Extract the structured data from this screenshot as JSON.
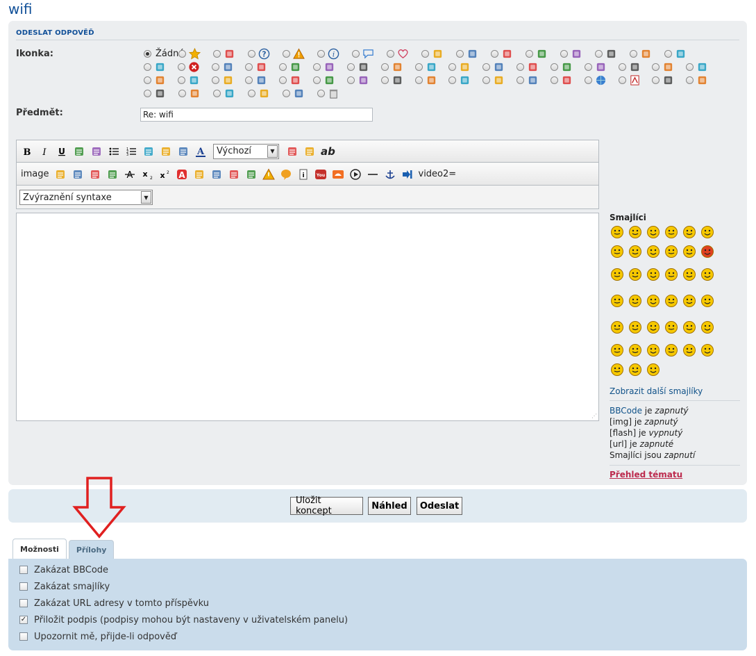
{
  "page": {
    "title": "wifi"
  },
  "form": {
    "heading": "Odeslat odpověď",
    "icon_label": "Ikonka:",
    "icon_none_label": "Žádné",
    "subject_label": "Předmět:",
    "subject_value": "Re: wifi"
  },
  "icons": [
    [
      "none",
      "star-icon",
      "radiation-icon",
      "question-icon",
      "warning-icon",
      "info-icon",
      "speech-bubble-icon",
      "heart-icon",
      "windows-icon",
      "tools-icon",
      "gear-icon",
      "pen-icon",
      "camera-icon",
      "music-icon",
      "back-icon",
      "sun-icon"
    ],
    [
      "lifebuoy-icon",
      "close-icon",
      "clock-icon",
      "traffic-light-icon",
      "monitor-icon",
      "laptop-icon",
      "calendar-icon",
      "padlock-icon",
      "film-icon",
      "printer-icon",
      "lightbulb-icon",
      "battery-icon",
      "palette-icon",
      "gamepad-icon",
      "antenna-icon",
      "signal-icon",
      "robot-icon"
    ],
    [
      "lifebuoy2-icon",
      "grid-icon",
      "document-icon",
      "apps-icon",
      "chart-icon",
      "database-icon",
      "picture-icon",
      "lock2-icon",
      "phone-icon",
      "keyboard-icon",
      "screen-icon",
      "photo-icon",
      "bar-chart-icon",
      "globe-icon",
      "pdf-icon",
      "floppy-icon",
      "print2-icon"
    ],
    [
      "cd-icon",
      "usb-icon",
      "stamp-icon",
      "flower-icon",
      "hat-icon",
      "trash-icon"
    ]
  ],
  "toolbar": {
    "row1": [
      "bold-icon",
      "italic-icon",
      "underline-icon",
      "quote-icon",
      "code-icon",
      "list-icon",
      "ordered-list-icon",
      "list-item-icon",
      "image-icon",
      "link-icon",
      "font-color-icon"
    ],
    "font_select": "Výchozí",
    "row1_tail": [
      "copy-icon",
      "paste-icon",
      "spellcheck-icon"
    ],
    "spellcheck_label": "ab",
    "image_label": "image",
    "row2": [
      "highlight-icon",
      "align-center-icon",
      "align-justify-icon",
      "align-right-icon",
      "strike-icon",
      "subscript-icon",
      "superscript-icon",
      "acronym-icon",
      "font-size-icon",
      "font-shadow-icon",
      "glow-icon",
      "direction-icon",
      "warning-icon",
      "spoiler-icon",
      "info-icon",
      "youtube-icon",
      "soundcloud-icon",
      "play-icon",
      "hr-icon",
      "anchor-icon",
      "arrow-icon"
    ],
    "video_label": "video2=",
    "syntax_select": "Zvýraznění syntaxe"
  },
  "smilies": {
    "title": "Smajlíci",
    "more_link": "Zobrazit další smajlíky",
    "rows": [
      6,
      6,
      6,
      6,
      6,
      6,
      3
    ]
  },
  "status": {
    "bbcode_link": "BBCode",
    "bbcode_text": " je ",
    "bbcode_state": "zapnutý",
    "img_text": "[img] je ",
    "img_state": "zapnutý",
    "flash_text": "[flash] je ",
    "flash_state": "vypnutý",
    "url_text": "[url] je ",
    "url_state": "zapnuté",
    "smilies_text": "Smajlíci jsou ",
    "smilies_state": "zapnutí",
    "topic_review": "Přehled tématu"
  },
  "buttons": {
    "save_draft": "Uložit koncept",
    "preview": "Náhled",
    "submit": "Odeslat"
  },
  "tabs": [
    {
      "label": "Možnosti",
      "active": true
    },
    {
      "label": "Přílohy",
      "active": false
    }
  ],
  "options": [
    {
      "label": "Zakázat BBCode",
      "checked": false
    },
    {
      "label": "Zakázat smajlíky",
      "checked": false
    },
    {
      "label": "Zakázat URL adresy v tomto příspěvku",
      "checked": false
    },
    {
      "label": "Přiložit podpis (podpisy mohou být nastaveny v uživatelském panelu)",
      "checked": true
    },
    {
      "label": "Upozornit mě, přijde-li odpověď",
      "checked": false
    }
  ],
  "colors": {
    "accent": "#115098",
    "panel": "#eceef0",
    "options_panel": "#cadceb",
    "arrow": "#e02020",
    "topic_review": "#bc2a4d"
  }
}
